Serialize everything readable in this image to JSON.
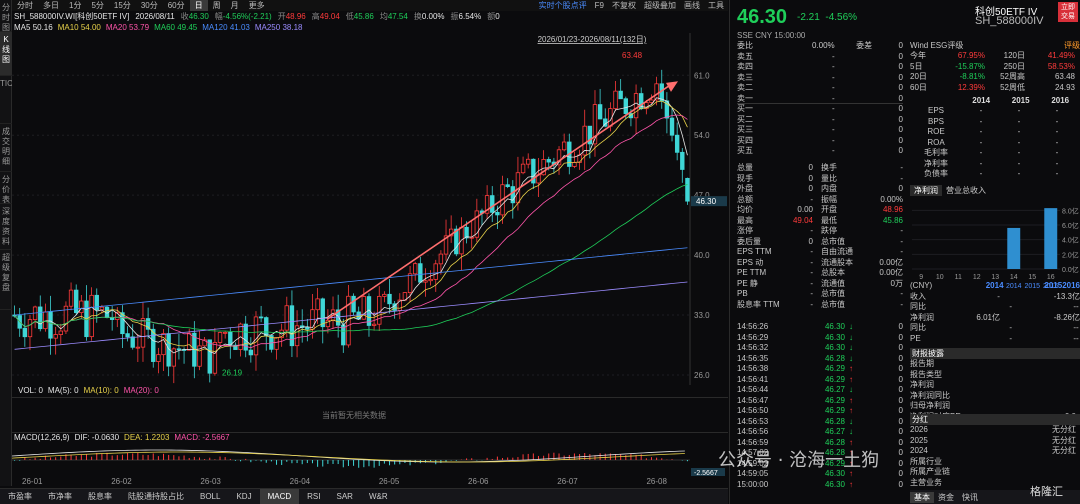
{
  "toolbar": {
    "items": [
      "分时",
      "多日",
      "1分",
      "5分",
      "15分",
      "30分",
      "60分",
      "日",
      "周",
      "月",
      "更多"
    ],
    "active": "日",
    "right": [
      "实时个股点评",
      "F9",
      "不复权",
      "超级叠加",
      "画线",
      "工具"
    ]
  },
  "left_tabs": [
    "分时图",
    "K线图",
    "TICK",
    "成交明细",
    "分价表",
    "深度资料",
    "超级复盘"
  ],
  "info": {
    "name": "SH_588000IV.WI[科创50ETF IV]",
    "date": "2026/08/11",
    "close_label": "收",
    "close": "46.30",
    "range_label": "幅",
    "range": "-4.56%(-2.21)",
    "open_label": "开",
    "open": "48.96",
    "high_label": "高",
    "high": "49.04",
    "low_label": "低",
    "low": "45.86",
    "avg_label": "均",
    "avg": "47.54",
    "turn_label": "换",
    "turn": "0.00%",
    "amp_label": "振",
    "amp": "6.54%",
    "amt_label": "额",
    "amt": "0"
  },
  "ma": [
    {
      "k": "MA5",
      "v": "50.16",
      "c": "#e6e6e6"
    },
    {
      "k": "MA10",
      "v": "54.00",
      "c": "#e8d24a"
    },
    {
      "k": "MA20",
      "v": "53.79",
      "c": "#ff55aa"
    },
    {
      "k": "MA60",
      "v": "49.45",
      "c": "#1fcf5a"
    },
    {
      "k": "MA120",
      "v": "41.03",
      "c": "#4a8cff"
    },
    {
      "k": "MA250",
      "v": "38.18",
      "c": "#9b8cff"
    }
  ],
  "range_label": "2026/01/23-2026/08/11(132日)",
  "chart_data": {
    "type": "candlestick",
    "yticks": [
      "61.0",
      "54.0",
      "47.0",
      "40.0",
      "33.0",
      "26.0"
    ],
    "ylim": [
      26,
      65
    ],
    "xticks": [
      "26-01",
      "26-02",
      "26-03",
      "26-04",
      "26-05",
      "26-06",
      "26-07",
      "26-08"
    ],
    "high_label": "63.48",
    "low_label": "26.19",
    "last_label": "46.30"
  },
  "vol": {
    "label": "VOL: 0",
    "ma5": "MA(5): 0",
    "ma10": "MA(10): 0",
    "ma20": "MA(20): 0",
    "empty": "当前暂无相关数据"
  },
  "macd": {
    "label": "MACD(12,26,9)",
    "dif": "DIF: -0.0630",
    "dea": "DEA: 1.2203",
    "macd": "MACD: -2.5667",
    "last": "-2.5667"
  },
  "bottom_tabs": [
    "市盈率",
    "市净率",
    "股息率",
    "陆股通持股占比",
    "BOLL",
    "KDJ",
    "MACD",
    "RSI",
    "SAR",
    "W&R"
  ],
  "bottom_active": "MACD",
  "quote": {
    "price": "46.30",
    "chg": "-2.21",
    "pct": "-4.56%",
    "symbol": "科创50ETF IV",
    "code": "SH_588000IV",
    "badge": "立即交易",
    "exch": "SSE  CNY  15:00:00"
  },
  "orderbook": [
    {
      "k": "委比",
      "v": "0.00%",
      "k2": "委差",
      "v2": "0"
    },
    {
      "k": "卖五",
      "v": "-",
      "v2": "0"
    },
    {
      "k": "卖四",
      "v": "-",
      "v2": "0"
    },
    {
      "k": "卖三",
      "v": "-",
      "v2": "0"
    },
    {
      "k": "卖二",
      "v": "-",
      "v2": "0"
    },
    {
      "k": "卖一",
      "v": "-",
      "v2": "0"
    },
    {
      "k": "买一",
      "v": "-",
      "v2": "0"
    },
    {
      "k": "买二",
      "v": "-",
      "v2": "0"
    },
    {
      "k": "买三",
      "v": "-",
      "v2": "0"
    },
    {
      "k": "买四",
      "v": "-",
      "v2": "0"
    },
    {
      "k": "买五",
      "v": "-",
      "v2": "0"
    }
  ],
  "stats": [
    [
      "总量",
      "0",
      "",
      "换手",
      "-"
    ],
    [
      "现手",
      "0",
      "",
      "量比",
      "-"
    ],
    [
      "外盘",
      "0",
      "",
      "内盘",
      "0"
    ],
    [
      "总额",
      "-",
      "",
      "振幅",
      "0.00%"
    ],
    [
      "均价",
      "0.00",
      "",
      "开盘",
      "48.96"
    ],
    [
      "最高",
      "49.04",
      "",
      "最低",
      "45.86"
    ],
    [
      "涨停",
      "-",
      "",
      "跌停",
      "-"
    ],
    [
      "委后量",
      "0",
      "",
      "总市值",
      "-"
    ],
    [
      "EPS TTM",
      "-",
      "",
      "自由流通",
      "-"
    ],
    [
      "EPS 动",
      "-",
      "",
      "流通股本",
      "0.00亿"
    ],
    [
      "PE TTM",
      "-",
      "",
      "总股本",
      "0.00亿"
    ],
    [
      "PE 静",
      "-",
      "",
      "流通值",
      "0万"
    ],
    [
      "PB",
      "-",
      "",
      "总市值",
      "-"
    ],
    [
      "股息率 TTM",
      "-",
      "",
      "总市值",
      "-"
    ]
  ],
  "ticks": [
    [
      "14:56:26",
      "46.30",
      "↓",
      "0"
    ],
    [
      "14:56:29",
      "46.30",
      "↓",
      "0"
    ],
    [
      "14:56:32",
      "46.30",
      "↓",
      "0"
    ],
    [
      "14:56:35",
      "46.28",
      "↓",
      "0"
    ],
    [
      "14:56:38",
      "46.29",
      "↑",
      "0"
    ],
    [
      "14:56:41",
      "46.29",
      "↑",
      "0"
    ],
    [
      "14:56:44",
      "46.27",
      "↓",
      "0"
    ],
    [
      "14:56:47",
      "46.29",
      "↑",
      "0"
    ],
    [
      "14:56:50",
      "46.29",
      "↑",
      "0"
    ],
    [
      "14:56:53",
      "46.28",
      "↓",
      "0"
    ],
    [
      "14:56:56",
      "46.27",
      "↓",
      "0"
    ],
    [
      "14:56:59",
      "46.28",
      "↑",
      "0"
    ],
    [
      "14:57:02",
      "46.28",
      "↑",
      "0"
    ],
    [
      "14:59:02",
      "46.29",
      "↑",
      "0"
    ],
    [
      "14:59:05",
      "46.30",
      "↑",
      "0"
    ],
    [
      "15:00:00",
      "46.30",
      "↑",
      "0"
    ]
  ],
  "esg": {
    "label": "Wind ESG评级",
    "action": "评级"
  },
  "ret": [
    [
      "今年",
      "67.95%",
      "120日",
      "41.49%"
    ],
    [
      "5日",
      "-15.87%",
      "250日",
      "58.53%"
    ],
    [
      "20日",
      "-8.81%",
      "52周高",
      "63.48"
    ],
    [
      "60日",
      "12.39%",
      "52周低",
      "24.93"
    ]
  ],
  "years": [
    "2014",
    "2015",
    "2016"
  ],
  "fin": [
    [
      "EPS",
      "-",
      "-",
      "-"
    ],
    [
      "BPS",
      "-",
      "-",
      "-"
    ],
    [
      "ROE",
      "-",
      "-",
      "-"
    ],
    [
      "ROA",
      "-",
      "-",
      "-"
    ],
    [
      "毛利率",
      "-",
      "-",
      "-"
    ],
    [
      "净利率",
      "-",
      "-",
      "-"
    ],
    [
      "负债率",
      "-",
      "-",
      "-"
    ]
  ],
  "rev_tabs": [
    "净利润",
    "营业总收入"
  ],
  "rev_chart": {
    "yticks": [
      "8.0亿",
      "6.0亿",
      "4.0亿",
      "2.0亿",
      "0.0亿"
    ],
    "x": [
      "9",
      "10",
      "11",
      "12",
      "13",
      "14",
      "15",
      "16"
    ],
    "values": [
      0,
      0,
      0,
      0,
      0,
      5.6,
      0,
      8.3
    ],
    "ylim": [
      0,
      9
    ],
    "year_ticks": [
      "2014",
      "2015",
      "2016"
    ]
  },
  "fin2": [
    [
      "(CNY)",
      "2014",
      "2015",
      "2016"
    ],
    [
      "收入",
      "-",
      "-",
      "13.3亿"
    ],
    [
      "同比",
      "-",
      "-",
      "-"
    ],
    [
      "净利润",
      "6.01亿",
      "-",
      "8.26亿"
    ],
    [
      "同比",
      "-",
      "-",
      "-"
    ],
    [
      "PE",
      "-",
      "-",
      "-"
    ]
  ],
  "disclosure": {
    "title": "财报披露",
    "items": [
      "报告期",
      "报告类型",
      "净利润",
      "净利润同比",
      "归母净利润",
      "净利润对应PE"
    ],
    "pe": "0.0"
  },
  "dividend": {
    "title": "分红",
    "rows": [
      [
        "2026",
        "无分红"
      ],
      [
        "2025",
        "无分红"
      ],
      [
        "2024",
        "无分红"
      ]
    ],
    "extra": [
      "所属行业",
      "所属产业链",
      "主营业务"
    ]
  },
  "rtabs": [
    "基本",
    "资金",
    "快讯"
  ],
  "rtab_active": "基本",
  "watermark": "公众号 · 沧海一土狗",
  "wm_logo": "格隆汇"
}
